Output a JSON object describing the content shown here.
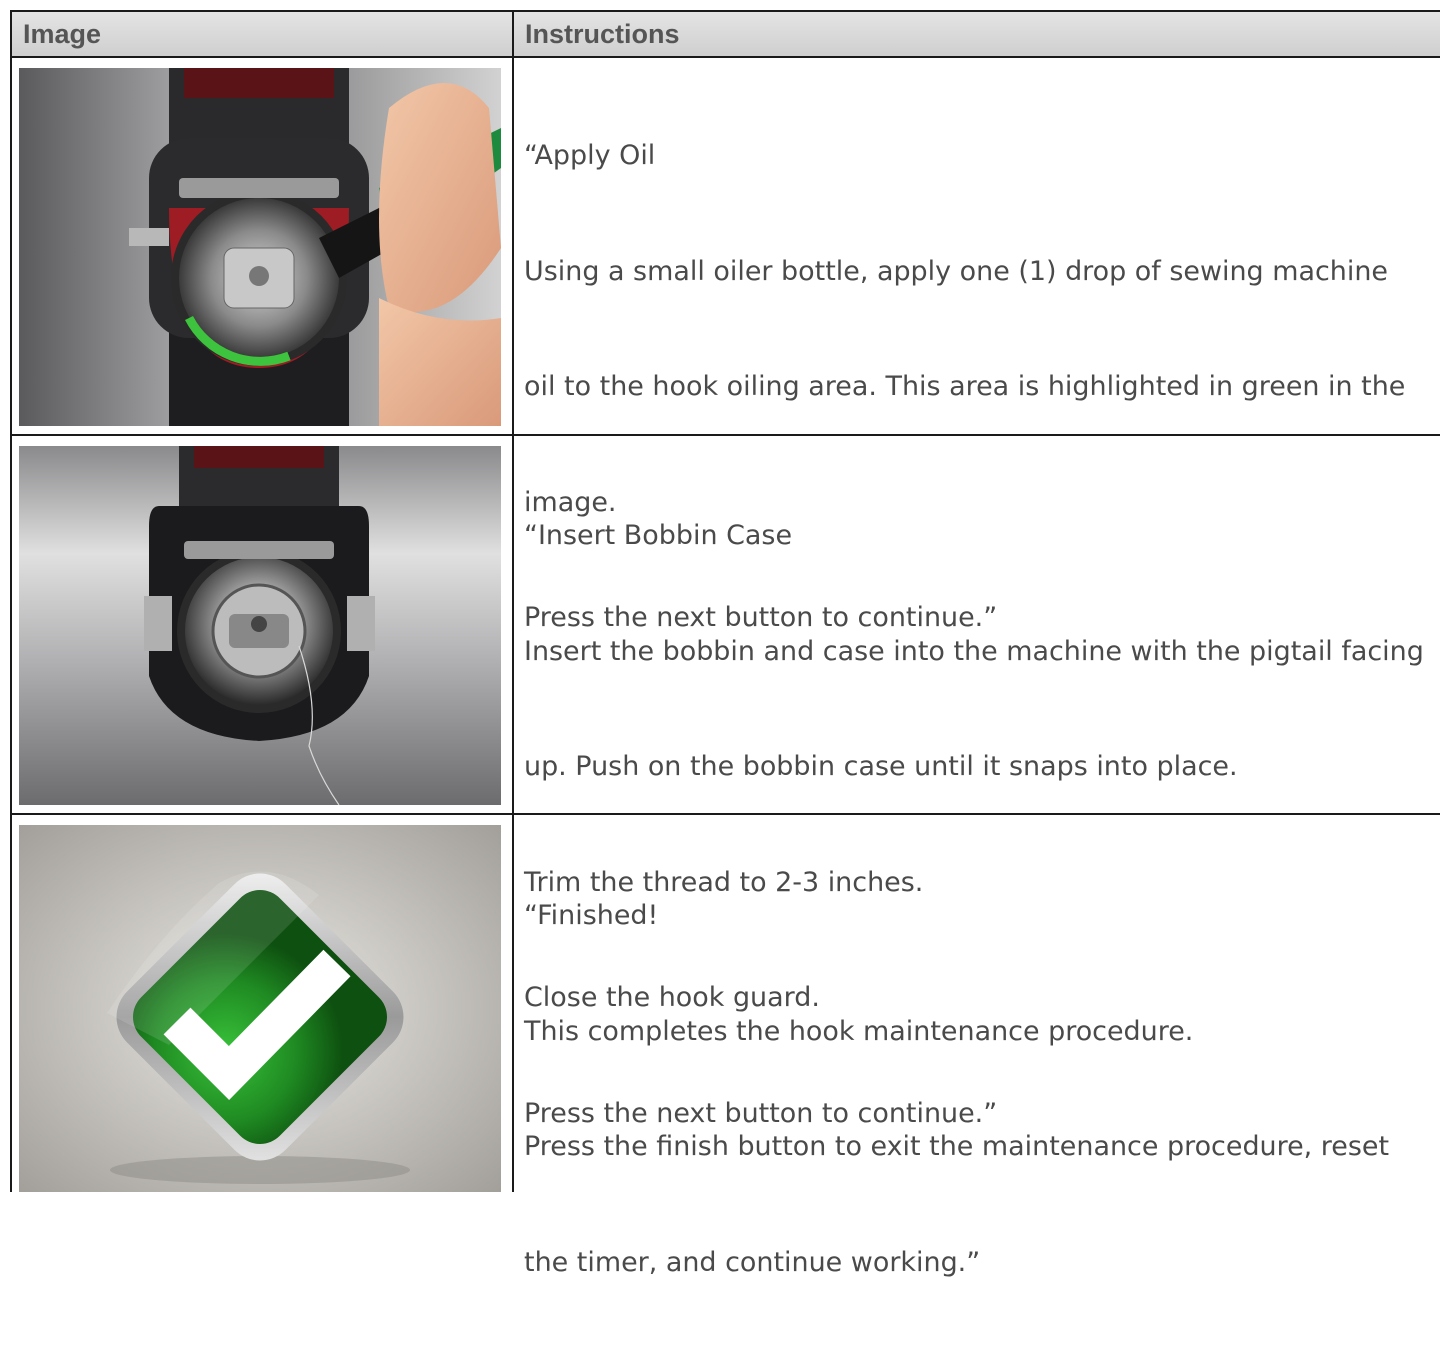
{
  "table": {
    "headers": {
      "image": "Image",
      "instructions": "Instructions"
    },
    "rows": [
      {
        "image_subject": "sewing machine hook with oiler pen applying oil to green highlighted area",
        "lines": [
          "“Apply Oil",
          "Using a small oiler bottle, apply one (1) drop of sewing machine",
          "oil to the hook oiling area. This area is highlighted in green in the",
          "image.",
          "Press the next button to continue.”"
        ]
      },
      {
        "image_subject": "bobbin case inserted in sewing machine hook with thread tail",
        "lines": [
          "“Insert Bobbin Case",
          "Insert the bobbin and case into the machine with the pigtail facing",
          "up. Push on the bobbin case until it snaps into place.",
          "Trim the thread to 2-3 inches.",
          "Close the hook guard.",
          "Press the next button to continue.”"
        ]
      },
      {
        "image_subject": "green diamond checkmark icon",
        "lines": [
          "“Finished!",
          "This completes the hook maintenance procedure.",
          "Press the finish button to exit the maintenance procedure, reset",
          "the timer, and continue working.”"
        ]
      }
    ]
  },
  "colors": {
    "accent_green": "#2a9a2a",
    "oil_highlight": "#3ec33e",
    "machine_red": "#9e1c24"
  }
}
